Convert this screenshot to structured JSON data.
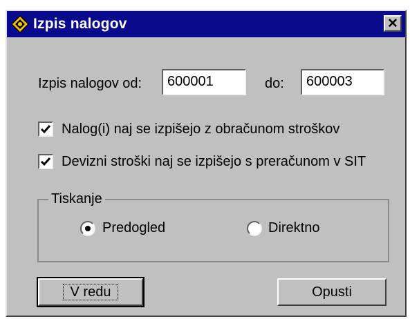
{
  "window": {
    "title": "Izpis nalogov",
    "close_label": "✕"
  },
  "range": {
    "from_label": "Izpis nalogov od:",
    "from_value": "600001",
    "to_label": "do:",
    "to_value": "600003"
  },
  "options": {
    "costs_label": "Nalog(i) naj se izpišejo z obračunom stroškov",
    "costs_checked": true,
    "currency_label": "Devizni stroški naj se izpišejo s preračunom v SIT",
    "currency_checked": true
  },
  "printing": {
    "group_label": "Tiskanje",
    "preview_label": "Predogled",
    "preview_selected": true,
    "direct_label": "Direktno",
    "direct_selected": false
  },
  "buttons": {
    "ok_label": "V redu",
    "cancel_label": "Opusti"
  }
}
